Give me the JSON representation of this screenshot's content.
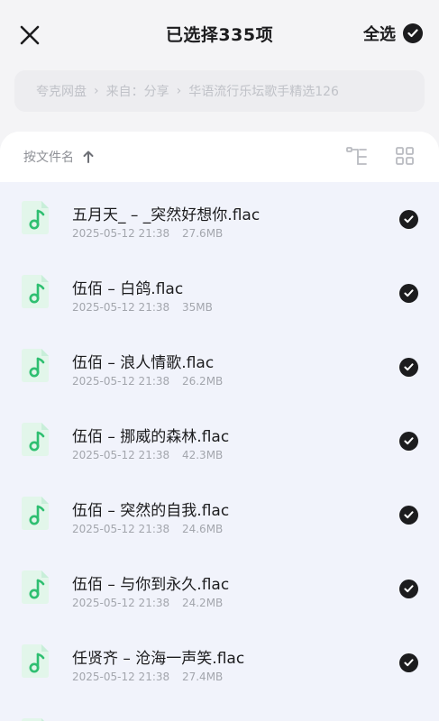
{
  "header": {
    "title": "已选择335项",
    "select_all_label": "全选"
  },
  "breadcrumb": {
    "items": [
      "夸克网盘",
      "来自：分享",
      "华语流行乐坛歌手精选126"
    ]
  },
  "sort": {
    "label": "按文件名"
  },
  "files": [
    {
      "name": "五月天_ – _突然好想你.flac",
      "date": "2025-05-12 21:38",
      "size": "27.6MB"
    },
    {
      "name": "伍佰 – 白鸽.flac",
      "date": "2025-05-12 21:38",
      "size": "35MB"
    },
    {
      "name": "伍佰 – 浪人情歌.flac",
      "date": "2025-05-12 21:38",
      "size": "26.2MB"
    },
    {
      "name": "伍佰 – 挪威的森林.flac",
      "date": "2025-05-12 21:38",
      "size": "42.3MB"
    },
    {
      "name": "伍佰 – 突然的自我.flac",
      "date": "2025-05-12 21:38",
      "size": "24.6MB"
    },
    {
      "name": "伍佰 – 与你到永久.flac",
      "date": "2025-05-12 21:38",
      "size": "24.2MB"
    },
    {
      "name": "任贤齐 – 沧海一声笑.flac",
      "date": "2025-05-12 21:38",
      "size": "27.4MB"
    }
  ],
  "colors": {
    "accent_green": "#2fbf71",
    "check_fill": "#1c1c1e",
    "list_background": "#f1f3fb"
  },
  "icons": {
    "close": "close-icon",
    "select_all_check": "check-circle-icon",
    "sort_direction": "arrow-up-icon",
    "tree_view": "tree-view-icon",
    "grid_view": "grid-view-icon",
    "file": "music-file-icon"
  }
}
